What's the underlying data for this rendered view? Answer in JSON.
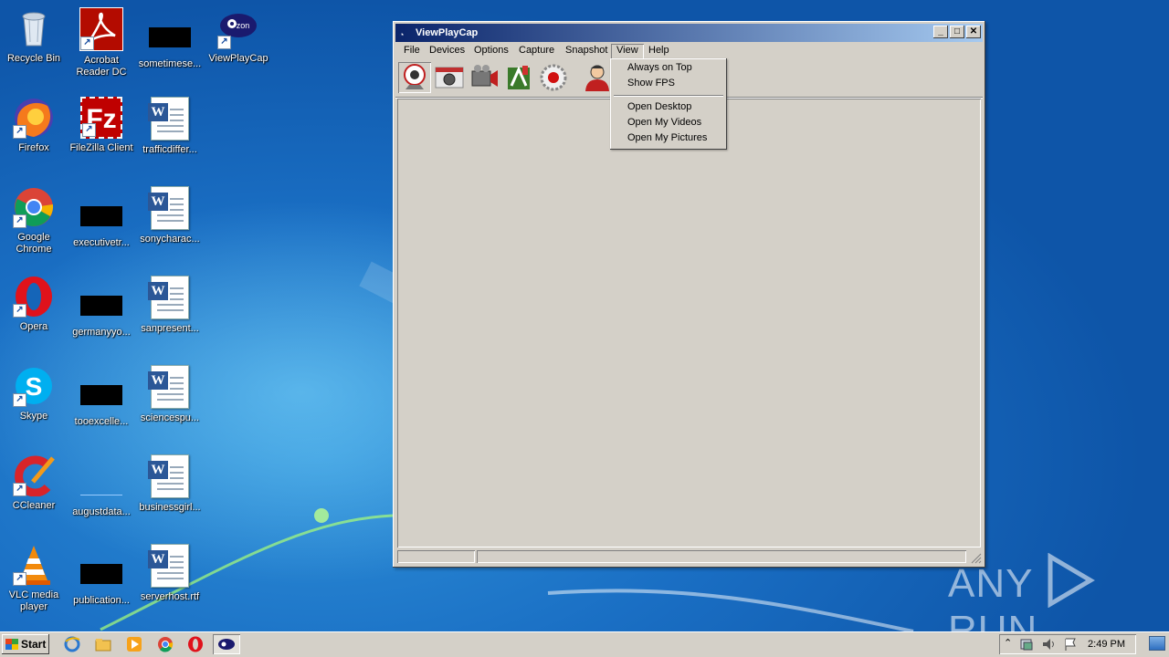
{
  "desktop": {
    "icons": [
      {
        "label": "Recycle Bin"
      },
      {
        "label": "Acrobat Reader DC"
      },
      {
        "label": "sometimese..."
      },
      {
        "label": "ViewPlayCap"
      },
      {
        "label": "Firefox"
      },
      {
        "label": "FileZilla Client"
      },
      {
        "label": "trafficdiffer..."
      },
      {
        "label": "Google Chrome"
      },
      {
        "label": "executivetr..."
      },
      {
        "label": "sonycharac..."
      },
      {
        "label": "Opera"
      },
      {
        "label": "germanyyo..."
      },
      {
        "label": "sanpresent..."
      },
      {
        "label": "Skype"
      },
      {
        "label": "tooexcelle..."
      },
      {
        "label": "sciencespu..."
      },
      {
        "label": "CCleaner"
      },
      {
        "label": "augustdata..."
      },
      {
        "label": "businessgirl..."
      },
      {
        "label": "VLC media player"
      },
      {
        "label": "publication..."
      },
      {
        "label": "serverhost.rtf"
      }
    ]
  },
  "window": {
    "title": "ViewPlayCap",
    "menu": [
      "File",
      "Devices",
      "Options",
      "Capture",
      "Snapshot",
      "View",
      "Help"
    ],
    "toolbar_icons": [
      "webcam-icon",
      "camera-icon",
      "video-camera-icon",
      "paint-icon",
      "record-icon",
      "user-icon"
    ],
    "view_menu": {
      "group1": [
        "Always on Top",
        "Show FPS"
      ],
      "group2": [
        "Open Desktop",
        "Open My Videos",
        "Open My Pictures"
      ]
    }
  },
  "taskbar": {
    "start_label": "Start",
    "clock": "2:49 PM"
  },
  "watermark": {
    "text_left": "ANY",
    "text_right": "RUN"
  },
  "colors": {
    "title_active_start": "#0a246a",
    "title_active_end": "#a6caf0",
    "face": "#d4d0c8"
  }
}
